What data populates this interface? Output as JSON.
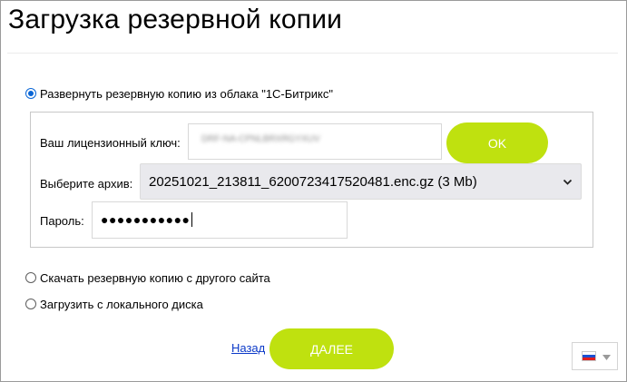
{
  "page": {
    "title": "Загрузка резервной копии"
  },
  "options": {
    "cloud": {
      "label": "Развернуть резервную копию из облака \"1С-Битрикс\"",
      "checked": true
    },
    "other_site": {
      "label": "Скачать резервную копию с другого сайта",
      "checked": false
    },
    "local_disk": {
      "label": "Загрузить с локального диска",
      "checked": false
    }
  },
  "cloud_form": {
    "license_label": "Ваш лицензионный ключ:",
    "license_value": "DRF-NA-CPNLBRXRGYXUV",
    "ok_label": "OK",
    "archive_label": "Выберите архив:",
    "archive_selected": "20251021_213811_6200723417520481.enc.gz (3 Mb)",
    "password_label": "Пароль:",
    "password_masked": "●●●●●●●●●●●"
  },
  "footer": {
    "back_label": "Назад",
    "next_label": "ДАЛЕЕ"
  },
  "language": {
    "icon": "flag-ru-icon"
  },
  "colors": {
    "accent_green": "#bfe10f",
    "radio_blue": "#0a66d6",
    "link_blue": "#0b39c8"
  }
}
